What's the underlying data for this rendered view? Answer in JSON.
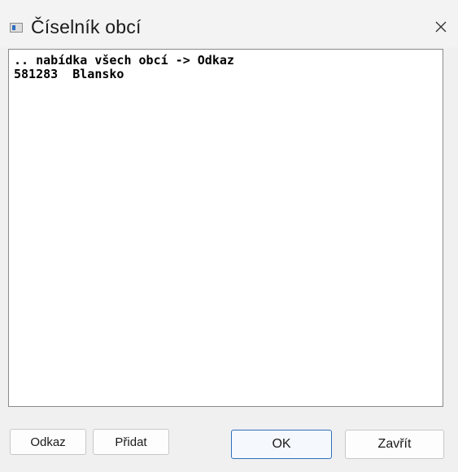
{
  "window": {
    "title": "Číselník obcí",
    "icon": "app-window-icon",
    "close_icon": "close-icon"
  },
  "list": {
    "items": [
      ".. nabídka všech obcí -> Odkaz",
      "581283  Blansko"
    ]
  },
  "buttons": {
    "odkaz": "Odkaz",
    "pridat": "Přidat",
    "ok": "OK",
    "zavrit": "Zavřít"
  },
  "colors": {
    "default_button_border": "#2e6fbf",
    "window_background": "#f0f0f0"
  }
}
